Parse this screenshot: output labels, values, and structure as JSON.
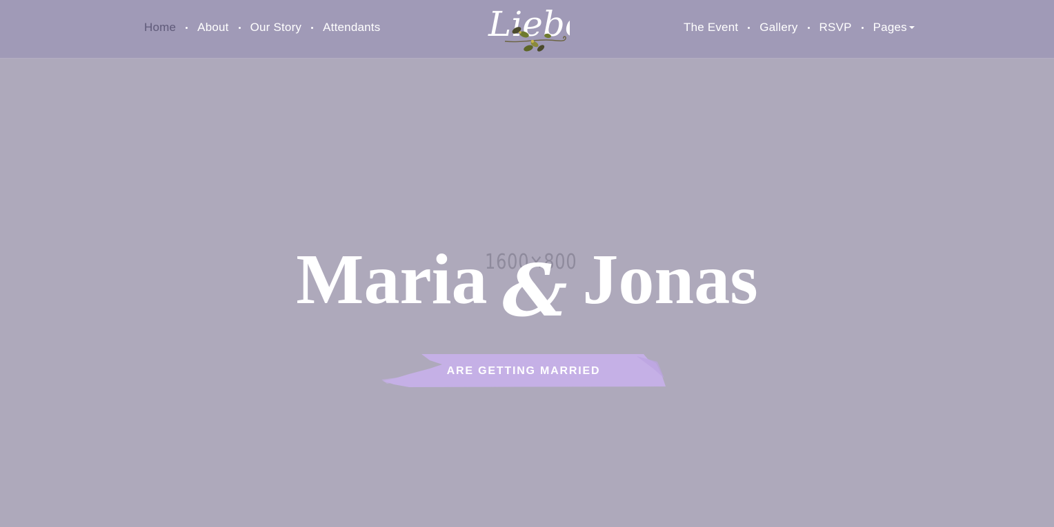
{
  "nav": {
    "left": [
      {
        "label": "Home",
        "active": true
      },
      {
        "label": "About"
      },
      {
        "label": "Our Story"
      },
      {
        "label": "Attendants"
      }
    ],
    "right": [
      {
        "label": "The Event"
      },
      {
        "label": "Gallery"
      },
      {
        "label": "RSVP"
      },
      {
        "label": "Pages",
        "has_dropdown": true
      }
    ]
  },
  "logo": {
    "text": "Liebe",
    "icon": "leaf-vine-icon"
  },
  "hero": {
    "placeholder_size": "1600×800",
    "name_one": "Maria",
    "ampersand": "&",
    "name_two": "Jonas",
    "tagline": "ARE GETTING MARRIED"
  },
  "colors": {
    "topbar": "#a09ab7",
    "background": "#aea9bb",
    "active_nav": "#5f5a79",
    "brush": "#c5b0e6",
    "text": "#ffffff"
  }
}
